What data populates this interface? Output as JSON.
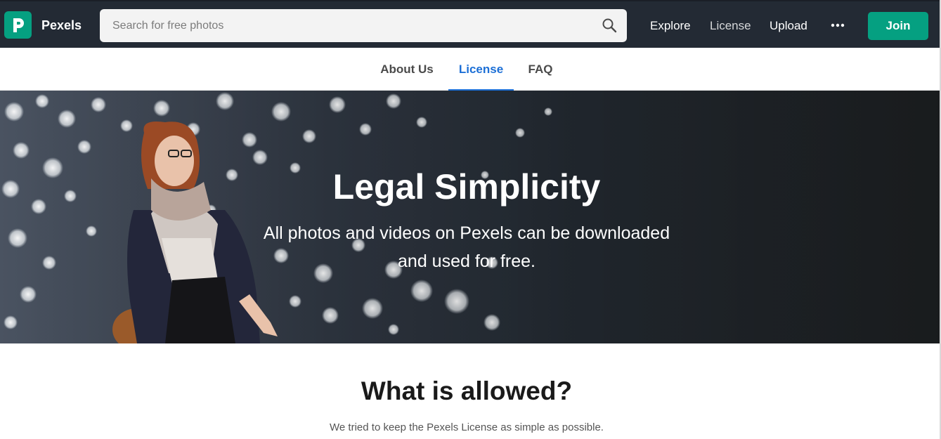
{
  "header": {
    "brand": "Pexels",
    "search_placeholder": "Search for free photos",
    "nav": {
      "explore": "Explore",
      "license": "License",
      "upload": "Upload"
    },
    "join_label": "Join",
    "accent_color": "#05a081"
  },
  "subnav": {
    "tabs": [
      {
        "label": "About Us",
        "active": false
      },
      {
        "label": "License",
        "active": true
      },
      {
        "label": "FAQ",
        "active": false
      }
    ],
    "active_color": "#1c6fd6"
  },
  "hero": {
    "title": "Legal Simplicity",
    "subtitle": "All photos and videos on Pexels can be downloaded and used for free."
  },
  "allowed": {
    "title": "What is allowed?",
    "subtitle": "We tried to keep the Pexels License as simple as possible."
  },
  "icons": {
    "logo": "pexels-logo-icon",
    "search": "search-icon",
    "more": "more-dots-icon"
  }
}
